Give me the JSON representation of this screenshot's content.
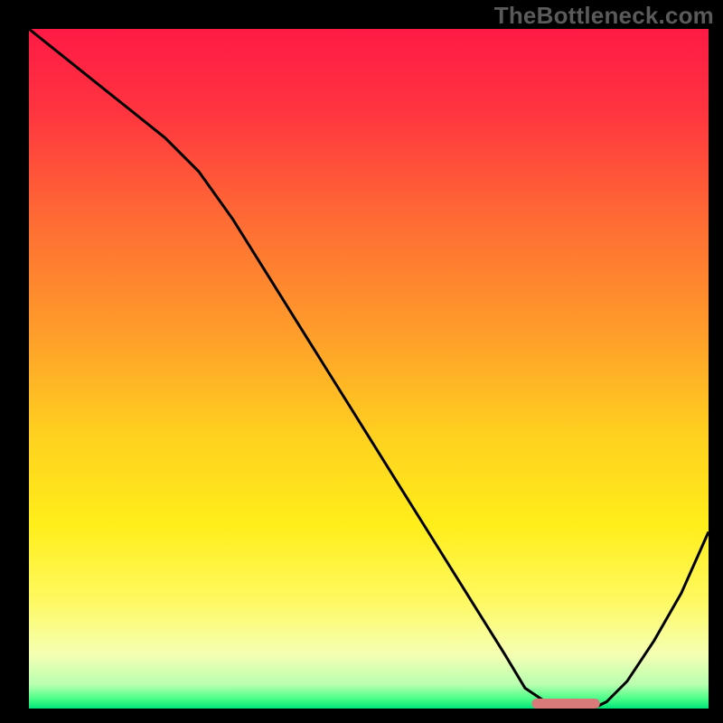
{
  "watermark": "TheBottleneck.com",
  "chart_data": {
    "type": "line",
    "title": "",
    "xlabel": "",
    "ylabel": "",
    "xlim": [
      0,
      100
    ],
    "ylim": [
      0,
      100
    ],
    "x": [
      0,
      5,
      10,
      15,
      20,
      25,
      30,
      35,
      40,
      45,
      50,
      55,
      60,
      65,
      70,
      73,
      76,
      80,
      83,
      85,
      88,
      92,
      96,
      100
    ],
    "values": [
      100,
      96,
      92,
      88,
      84,
      79,
      72,
      64,
      56,
      48,
      40,
      32,
      24,
      16,
      8,
      3,
      1,
      0,
      0,
      1,
      4,
      10,
      17,
      26
    ],
    "optimum_marker": {
      "x_start": 74,
      "x_end": 84,
      "y": 0
    },
    "gradient_stops": [
      {
        "offset": 0.0,
        "color": "#ff1a45"
      },
      {
        "offset": 0.12,
        "color": "#ff3440"
      },
      {
        "offset": 0.28,
        "color": "#ff6b34"
      },
      {
        "offset": 0.45,
        "color": "#ff9e2a"
      },
      {
        "offset": 0.6,
        "color": "#ffd11f"
      },
      {
        "offset": 0.73,
        "color": "#ffee1a"
      },
      {
        "offset": 0.84,
        "color": "#fff960"
      },
      {
        "offset": 0.92,
        "color": "#f5ffb3"
      },
      {
        "offset": 0.965,
        "color": "#b8ffb0"
      },
      {
        "offset": 0.985,
        "color": "#4dff88"
      },
      {
        "offset": 1.0,
        "color": "#00e47a"
      }
    ],
    "curve_color": "#000000",
    "marker_color": "#d97a7a",
    "background_color": "#000000"
  }
}
